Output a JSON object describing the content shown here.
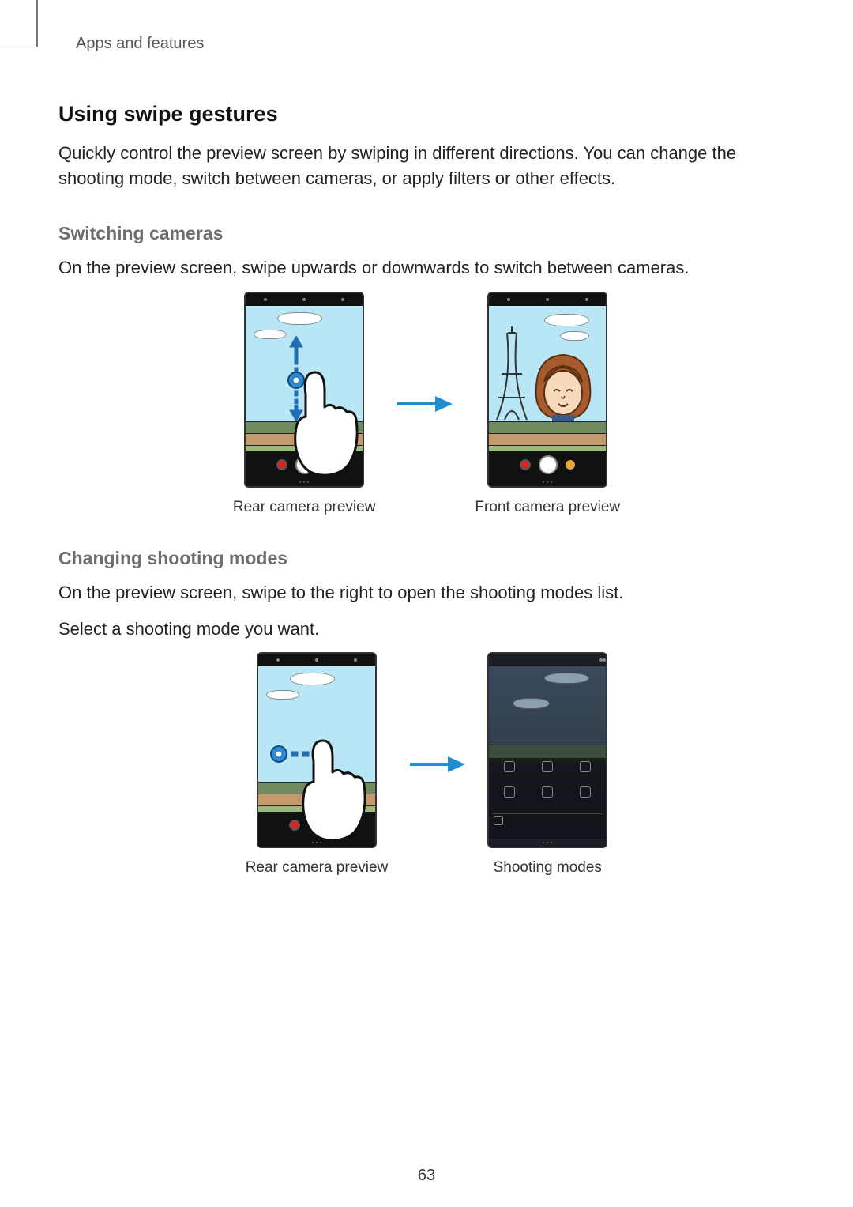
{
  "breadcrumb": "Apps and features",
  "heading": "Using swipe gestures",
  "intro": "Quickly control the preview screen by swiping in different directions. You can change the shooting mode, switch between cameras, or apply filters or other effects.",
  "section1": {
    "title": "Switching cameras",
    "body": "On the preview screen, swipe upwards or downwards to switch between cameras.",
    "caption_left": "Rear camera preview",
    "caption_right": "Front camera preview"
  },
  "section2": {
    "title": "Changing shooting modes",
    "body1": "On the preview screen, swipe to the right to open the shooting modes list.",
    "body2": "Select a shooting mode you want.",
    "caption_left": "Rear camera preview",
    "caption_right": "Shooting modes"
  },
  "page_number": "63"
}
